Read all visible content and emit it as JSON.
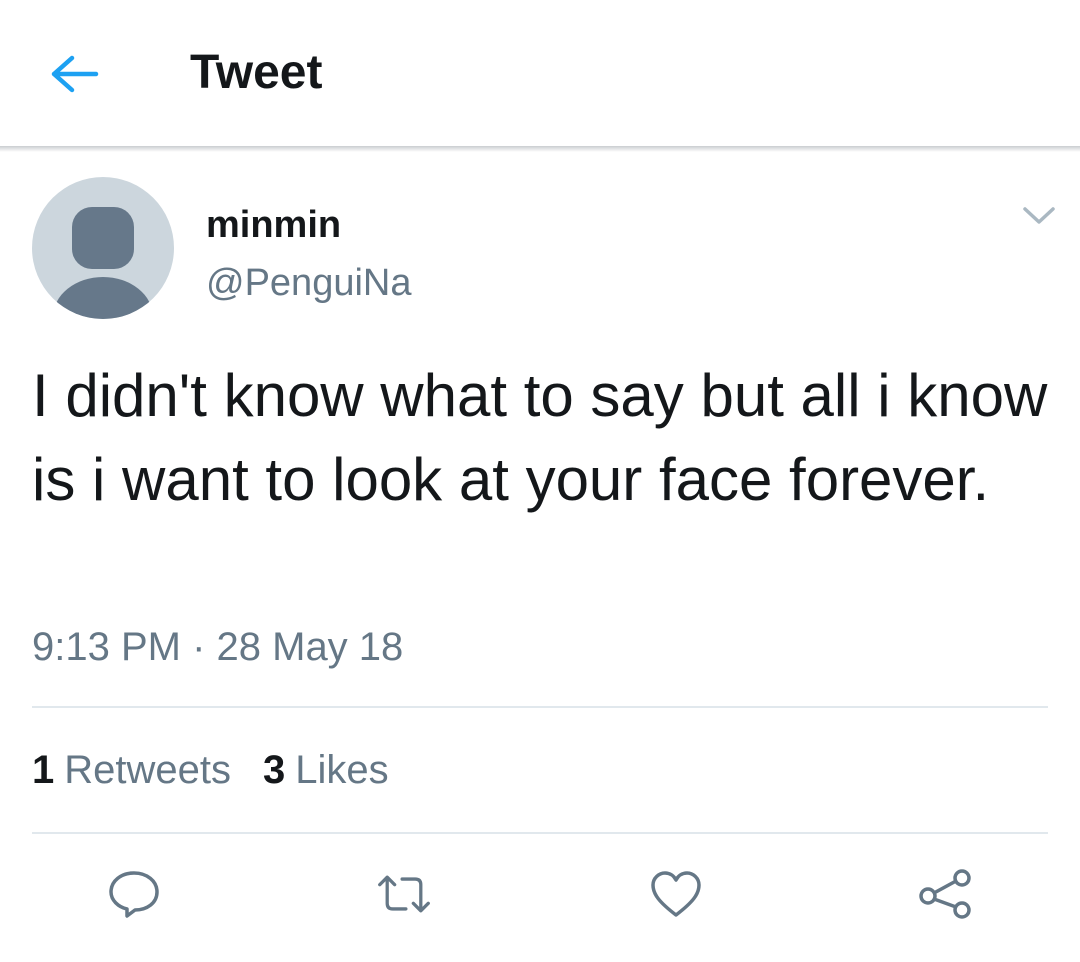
{
  "header": {
    "title": "Tweet",
    "back_icon": "arrow-left-icon",
    "accent": "#1da1f2"
  },
  "author": {
    "name": "minmin",
    "handle": "@PenguiNa",
    "avatar_icon": "default-profile-icon",
    "menu_icon": "chevron-down-icon"
  },
  "tweet": {
    "text": "I didn't know what to say but all i know is i want to look at your face forever.",
    "timestamp": "9:13 PM · 28 May 18"
  },
  "stats": {
    "retweets_count": "1",
    "retweets_label": "Retweets",
    "likes_count": "3",
    "likes_label": "Likes"
  },
  "actions": {
    "reply_icon": "reply-icon",
    "retweet_icon": "retweet-icon",
    "like_icon": "heart-icon",
    "share_icon": "share-icon"
  },
  "colors": {
    "text_primary": "#14171a",
    "text_secondary": "#657786",
    "divider": "#e1e8ed",
    "avatar_bg": "#ccd6dd",
    "avatar_fg": "#66788a"
  }
}
